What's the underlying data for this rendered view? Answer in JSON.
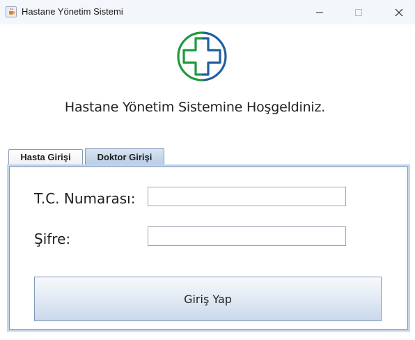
{
  "window": {
    "title": "Hastane Yönetim Sistemi",
    "icon": "java-cup-icon",
    "controls": [
      "minimize",
      "maximize",
      "close"
    ]
  },
  "logo": {
    "icon": "medical-cross-logo",
    "colors": {
      "green": "#1f9a3a",
      "blue": "#1f5fa0"
    }
  },
  "welcome_text": "Hastane Yönetim Sistemine Hoşgeldiniz.",
  "tabs": [
    {
      "label": "Hasta Girişi",
      "selected": false
    },
    {
      "label": "Doktor Girişi",
      "selected": true
    }
  ],
  "form": {
    "tc_label": "T.C. Numarası:",
    "tc_value": "",
    "password_label": "Şifre:",
    "password_value": "",
    "submit_label": "Giriş Yap"
  }
}
